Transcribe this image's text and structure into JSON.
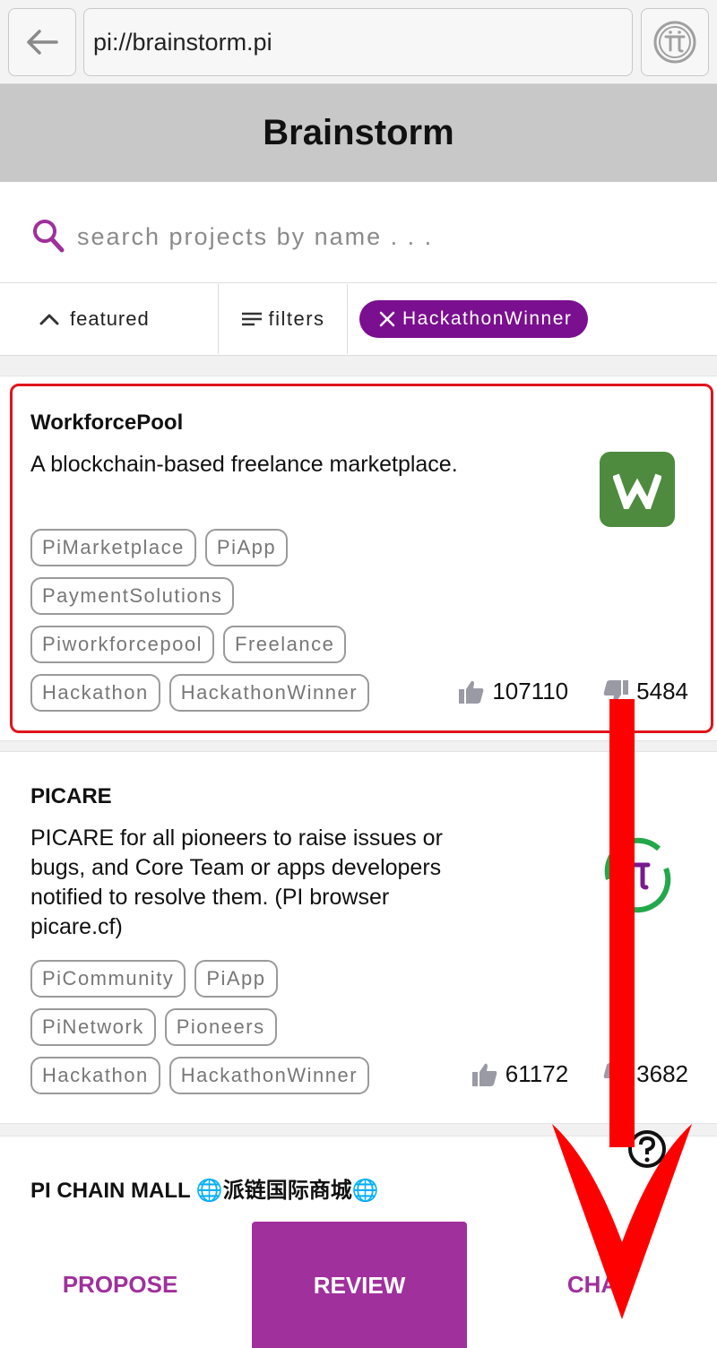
{
  "browser": {
    "url": "pi://brainstorm.pi",
    "back_icon": "arrow-left-icon",
    "pi_icon": "pi-logo-icon"
  },
  "header": {
    "title": "Brainstorm"
  },
  "search": {
    "placeholder": "search projects by name . . ."
  },
  "filters": {
    "featured_label": "featured",
    "filters_label": "filters",
    "active_chip": "HackathonWinner"
  },
  "projects": [
    {
      "title": "WorkforcePool",
      "description": "A blockchain-based freelance marketplace.",
      "tags": [
        [
          "PiMarketplace",
          "PiApp"
        ],
        [
          "PaymentSolutions"
        ],
        [
          "Piworkforcepool",
          "Freelance"
        ],
        [
          "Hackathon",
          "HackathonWinner"
        ]
      ],
      "likes": "107110",
      "dislikes": "5484",
      "logo_color": "#4e8b3e"
    },
    {
      "title": "PICARE",
      "description": "PICARE for all pioneers to raise issues or bugs, and Core Team or apps developers notified to resolve them. (PI browser picare.cf)",
      "tags": [
        [
          "PiCommunity",
          "PiApp"
        ],
        [
          "PiNetwork",
          "Pioneers"
        ],
        [
          "Hackathon",
          "HackathonWinner"
        ]
      ],
      "likes": "61172",
      "dislikes": "3682"
    },
    {
      "title": "PI CHAIN MALL 🌐派链国际商城🌐"
    }
  ],
  "bottom_nav": {
    "propose": "PROPOSE",
    "review": "REVIEW",
    "chat": "CHAT"
  },
  "colors": {
    "accent": "#a0309c",
    "chip": "#7a0f8f",
    "highlight": "#e0141c"
  }
}
